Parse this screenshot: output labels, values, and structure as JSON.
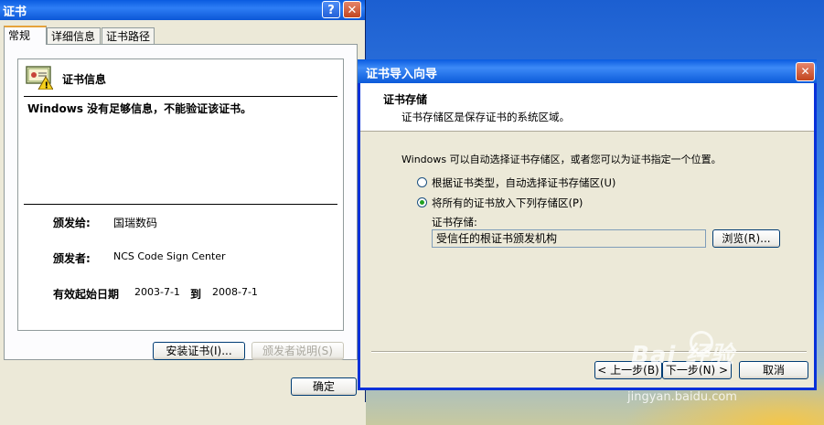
{
  "cert_dialog": {
    "title": "证书",
    "help_btn": "?",
    "close_btn": "✕",
    "tabs": [
      "常规",
      "详细信息",
      "证书路径"
    ],
    "info_title": "证书信息",
    "warning": "Windows 没有足够信息，不能验证该证书。",
    "issued_to_label": "颁发给:",
    "issued_to_value": "国瑞数码",
    "issued_by_label": "颁发者:",
    "issued_by_value": "NCS Code Sign Center",
    "validity_label": "有效起始日期",
    "validity_from": "2003-7-1",
    "validity_to_label": "到",
    "validity_to": "2008-7-1",
    "install_button": "安装证书(I)...",
    "issuer_statement_button": "颁发者说明(S)",
    "ok_button": "确定"
  },
  "wizard": {
    "title": "证书导入向导",
    "close_btn": "✕",
    "header_title": "证书存储",
    "header_subtitle": "证书存储区是保存证书的系统区域。",
    "description": "Windows 可以自动选择证书存储区，或者您可以为证书指定一个位置。",
    "option_auto": "根据证书类型，自动选择证书存储区(U)",
    "option_manual": "将所有的证书放入下列存储区(P)",
    "selected_option": "manual",
    "store_label": "证书存储:",
    "store_value": "受信任的根证书颁发机构",
    "browse_button": "浏览(R)...",
    "back_button": "< 上一步(B)",
    "next_button": "下一步(N) >",
    "cancel_button": "取消"
  },
  "watermark": {
    "text": "Bai 经验",
    "url": "jingyan.baidu.com"
  }
}
